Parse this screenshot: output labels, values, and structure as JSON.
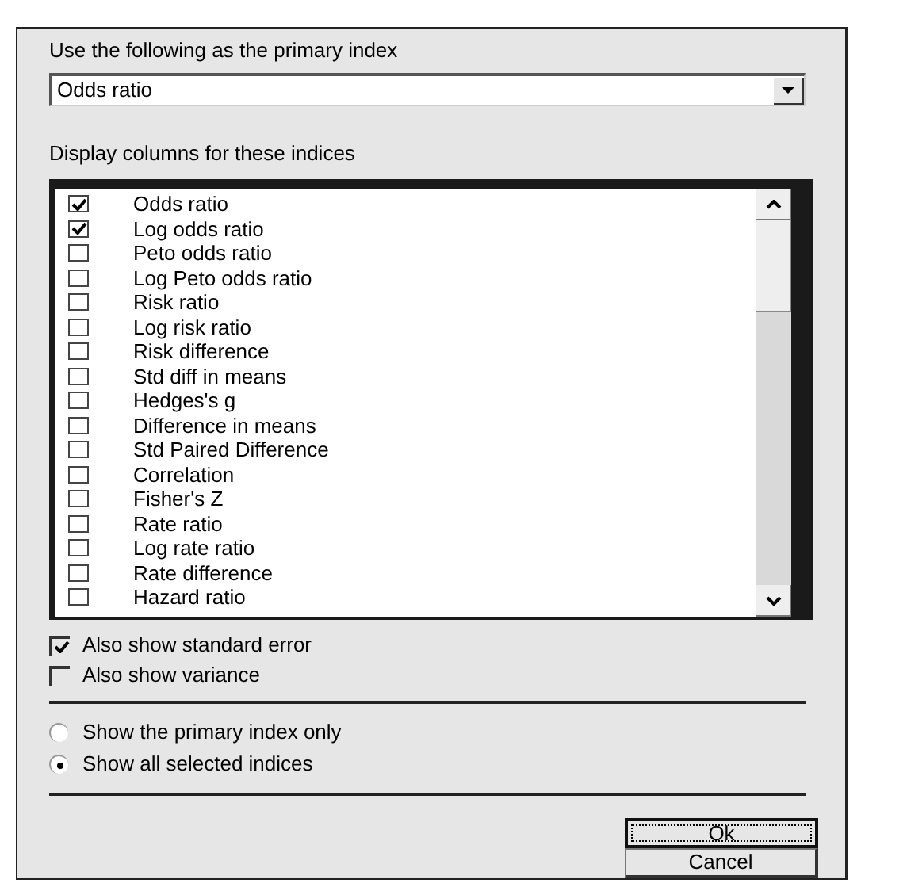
{
  "primary_index": {
    "label": "Use the following as the primary index",
    "value": "Odds ratio"
  },
  "indices": {
    "label": "Display columns for these indices",
    "items": [
      {
        "label": "Odds ratio",
        "checked": true
      },
      {
        "label": "Log odds ratio",
        "checked": true
      },
      {
        "label": "Peto odds ratio",
        "checked": false
      },
      {
        "label": "Log Peto odds ratio",
        "checked": false
      },
      {
        "label": "Risk ratio",
        "checked": false
      },
      {
        "label": "Log risk ratio",
        "checked": false
      },
      {
        "label": "Risk difference",
        "checked": false
      },
      {
        "label": "Std diff in means",
        "checked": false
      },
      {
        "label": "Hedges's g",
        "checked": false
      },
      {
        "label": "Difference in means",
        "checked": false
      },
      {
        "label": "Std Paired Difference",
        "checked": false
      },
      {
        "label": "Correlation",
        "checked": false
      },
      {
        "label": "Fisher's Z",
        "checked": false
      },
      {
        "label": "Rate ratio",
        "checked": false
      },
      {
        "label": "Log rate ratio",
        "checked": false
      },
      {
        "label": "Rate difference",
        "checked": false
      },
      {
        "label": "Hazard ratio",
        "checked": false
      }
    ]
  },
  "options": [
    {
      "label": "Also show standard error",
      "checked": true
    },
    {
      "label": "Also show variance",
      "checked": false
    }
  ],
  "display_mode": [
    {
      "label": "Show the primary index only",
      "selected": false
    },
    {
      "label": "Show all selected indices",
      "selected": true
    }
  ],
  "buttons": [
    {
      "label": "Ok",
      "focused": true
    },
    {
      "label": "Cancel",
      "focused": false
    }
  ]
}
